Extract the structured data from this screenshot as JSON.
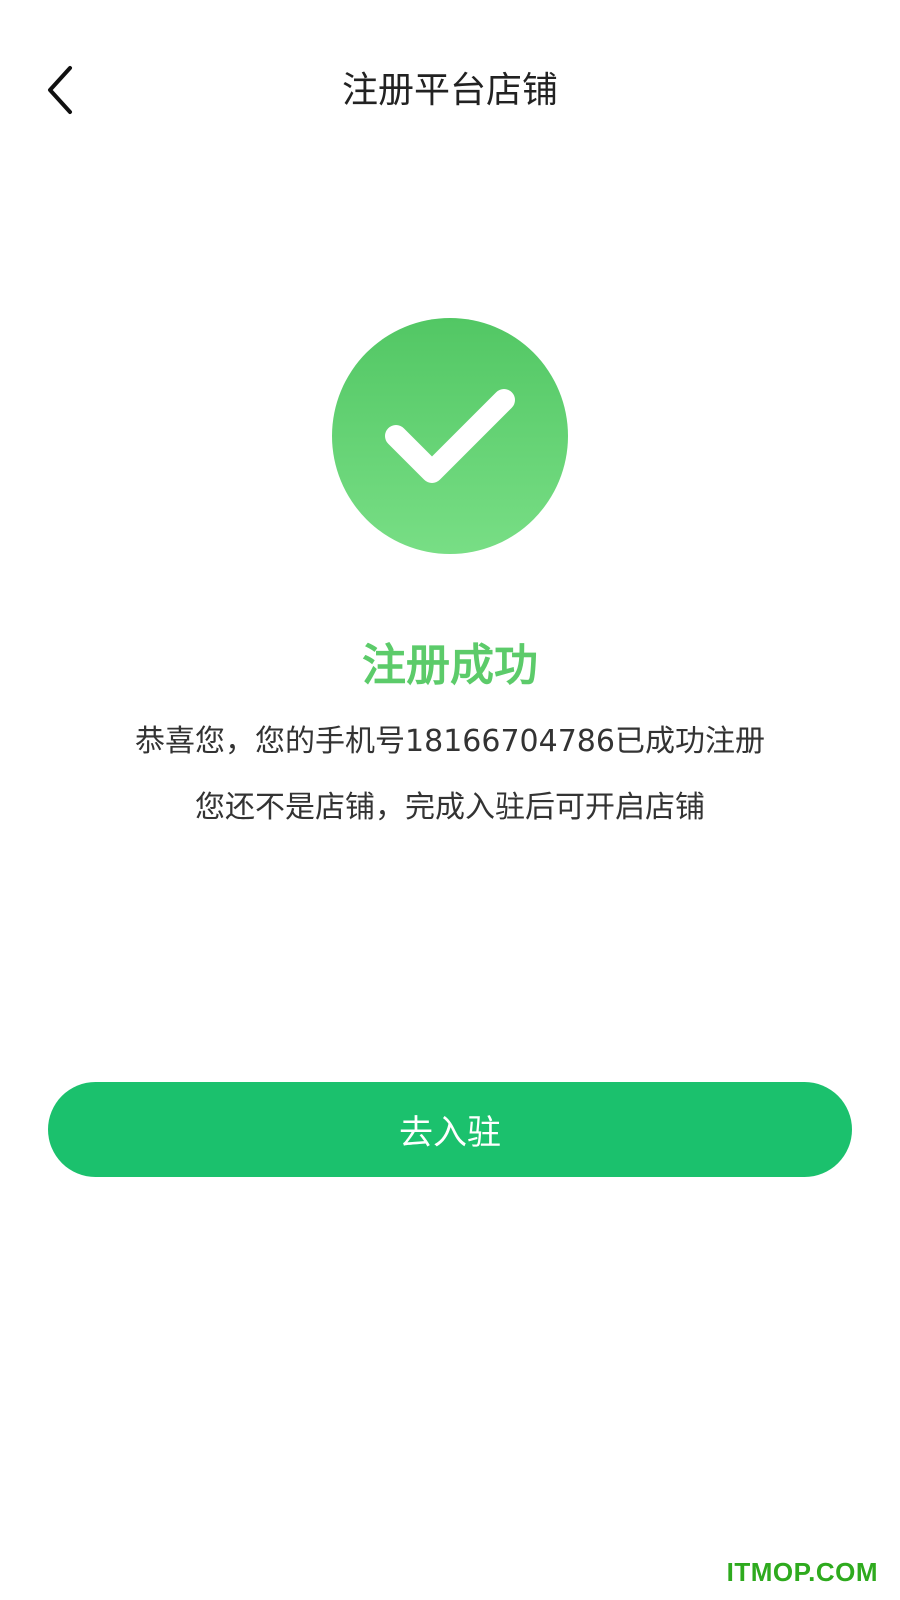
{
  "header": {
    "title": "注册平台店铺",
    "back_icon": "chevron-left-icon"
  },
  "success": {
    "icon": "check-circle-icon",
    "title": "注册成功",
    "message_line1": "恭喜您，您的手机号18166704786已成功注册",
    "message_line2": "您还不是店铺，完成入驻后可开启店铺"
  },
  "actions": {
    "settle_label": "去入驻"
  },
  "watermark": {
    "text": "ITMOP.COM"
  },
  "colors": {
    "accent_green": "#5ccb6a",
    "icon_top": "#52c764",
    "icon_bottom": "#78de85",
    "button_green": "#1bc16d",
    "watermark_green": "#2eaa1e"
  }
}
